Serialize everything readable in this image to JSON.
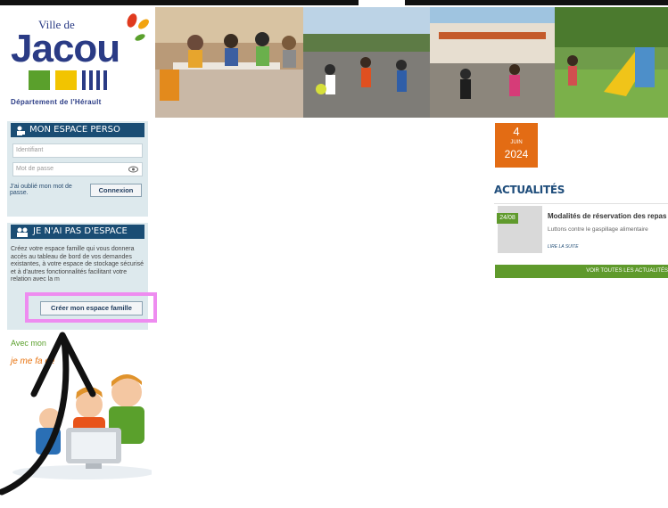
{
  "logo": {
    "ville_de": "Ville de",
    "name": "Jacou",
    "department": "Département de l'Hérault",
    "bar_colors": [
      "#5aa02c",
      "#f2c400",
      "#2a3b85"
    ]
  },
  "login": {
    "header_icon": "user-lock-icon",
    "title": "MON ESPACE PERSO",
    "username_placeholder": "Identifiant",
    "password_placeholder": "Mot de passe",
    "password_toggle_icon": "eye-icon",
    "forgot_link": "J'ai oublié mon mot de passe.",
    "connect_button": "Connexion"
  },
  "signup": {
    "header_icon": "users-icon",
    "title": "JE N'AI PAS D'ESPACE",
    "description": "Créez votre espace famille qui vous donnera accès au tableau de bord de vos demandes existantes, à votre espace de stockage sécurisé et à d'autres fonctionnalités facilitant votre relation avec la m",
    "create_button": "Créer mon espace famille"
  },
  "promo": {
    "line1": "Avec mon",
    "line2": "je me fa         e !"
  },
  "date": {
    "day": "4",
    "month": "JUIN",
    "year": "2024"
  },
  "news": {
    "section_title": "ACTUALITÉS",
    "items": [
      {
        "badge": "24/08",
        "headline": "Modalités de réservation des repas",
        "summary": "Luttons contre le gaspillage alimentaire",
        "read_more": "LIRE LA SUITE"
      }
    ],
    "all_link": "VOIR TOUTES LES ACTUALITÉS"
  },
  "colors": {
    "header_blue": "#1a4d74",
    "panel_bg": "#dde9ed",
    "accent_orange": "#e36c14",
    "accent_green": "#5f9a2c",
    "highlight_pink": "#ee8cf0"
  }
}
